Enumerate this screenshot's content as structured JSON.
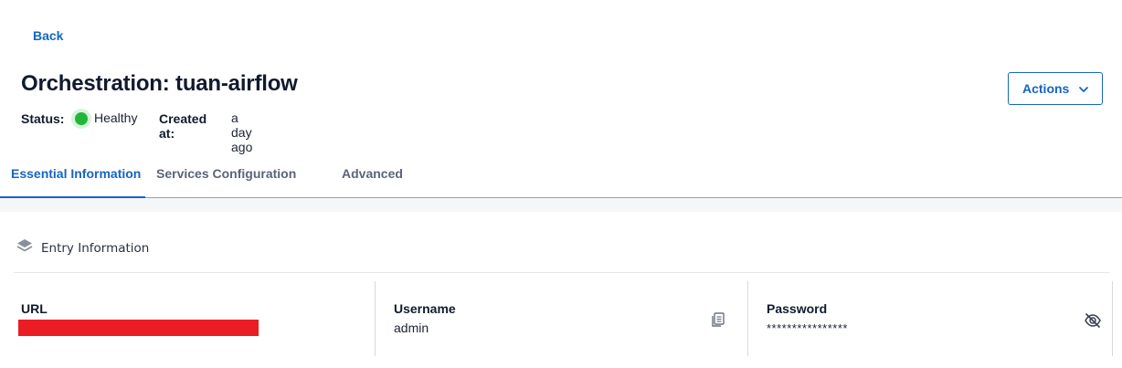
{
  "nav": {
    "back_label": "Back"
  },
  "header": {
    "title": "Orchestration: tuan-airflow",
    "status_label": "Status:",
    "status_value": "Healthy",
    "status_color": "#22b53a",
    "created_label": "Created at:",
    "created_value": "a day ago",
    "actions_label": "Actions",
    "actions_icon": "chevron-down-icon"
  },
  "tabs": [
    {
      "label": "Essential Information",
      "active": true
    },
    {
      "label": "Services Configuration",
      "active": false
    },
    {
      "label": "Advanced",
      "active": false
    }
  ],
  "entry_section": {
    "title": "Entry Information",
    "icon": "layers-icon",
    "fields": {
      "url": {
        "label": "URL",
        "value": "",
        "redacted": true,
        "redaction_color": "#ea1c24"
      },
      "username": {
        "label": "Username",
        "value": "admin",
        "action_icon": "copy-icon"
      },
      "password": {
        "label": "Password",
        "value": "****************",
        "action_icon": "eye-off-icon"
      }
    }
  },
  "colors": {
    "accent": "#1565c0",
    "text": "#111a2e"
  }
}
